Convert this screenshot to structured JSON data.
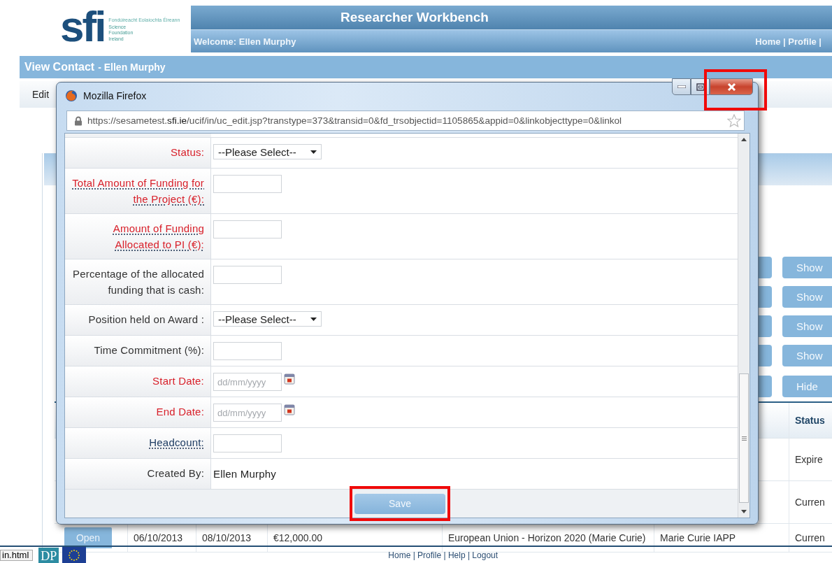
{
  "app": {
    "logo": {
      "mark": "sfi",
      "irish_name": "Fondúireacht Eolaíochta Éireann",
      "name_lines": [
        "Science",
        "Foundation",
        "Ireland"
      ]
    },
    "title": "Researcher Workbench",
    "welcome": "Welcome: Ellen Murphy",
    "top_links": "Home | Profile |"
  },
  "page_header": {
    "title": "View Contact",
    "subtitle": "- Ellen Murphy"
  },
  "toolbar": [
    "Edit"
  ],
  "side_buttons": [
    {
      "label": "Show"
    },
    {
      "label": "Show"
    },
    {
      "label": "Show"
    },
    {
      "label": "Show"
    },
    {
      "label": "Hide"
    }
  ],
  "table": {
    "column_headers": {
      "column_7": "Status"
    },
    "rows": [
      {
        "column_7": "Expire"
      },
      {
        "column_7": "Curren"
      },
      {
        "column_1": "Open",
        "column_2": "06/10/2013",
        "column_3": "08/10/2013",
        "column_4": "€12,000.00",
        "column_5": "European Union - Horizon 2020 (Marie Curie)",
        "column_6": "Marie Curie IAPP",
        "column_7": "Curren"
      }
    ]
  },
  "footer": {
    "links": "Home | Profile | Help | Logout",
    "status_link": "in.html",
    "logo_text": "DP"
  },
  "popup": {
    "window": {
      "title": "Mozilla Firefox",
      "close_highlighted": true
    },
    "url": {
      "prefix": "https://sesametest.",
      "domain": "sfi.ie",
      "path": "/ucif/in/uc_edit.jsp?transtype=373&transid=0&fd_trsobjectid=1105865&appid=0&linkobjecttype=0&linkol"
    },
    "fields": [
      {
        "label": "Status:",
        "required": true,
        "help": false,
        "kind": "select",
        "value": "--Please Select--"
      },
      {
        "label": "Total Amount of Funding for the Project (€):",
        "required": true,
        "help": true,
        "kind": "text"
      },
      {
        "label": "Amount of Funding Allocated to PI (€):",
        "required": true,
        "help": true,
        "kind": "text"
      },
      {
        "label": "Percentage of the allocated funding that is cash:",
        "required": false,
        "help": false,
        "kind": "text"
      },
      {
        "label": "Position held on Award :",
        "required": false,
        "help": false,
        "kind": "select",
        "value": "--Please Select--"
      },
      {
        "label": "Time Commitment (%):",
        "required": false,
        "help": false,
        "kind": "text"
      },
      {
        "label": "Start Date:",
        "required": true,
        "help": false,
        "kind": "date",
        "placeholder": "dd/mm/yyyy"
      },
      {
        "label": "End Date:",
        "required": true,
        "help": false,
        "kind": "date",
        "placeholder": "dd/mm/yyyy"
      },
      {
        "label": "Headcount:",
        "required": false,
        "help": true,
        "kind": "text"
      },
      {
        "label": "Created By:",
        "required": false,
        "help": false,
        "kind": "static",
        "value": "Ellen Murphy"
      }
    ],
    "save": {
      "label": "Save",
      "highlighted": true
    }
  }
}
